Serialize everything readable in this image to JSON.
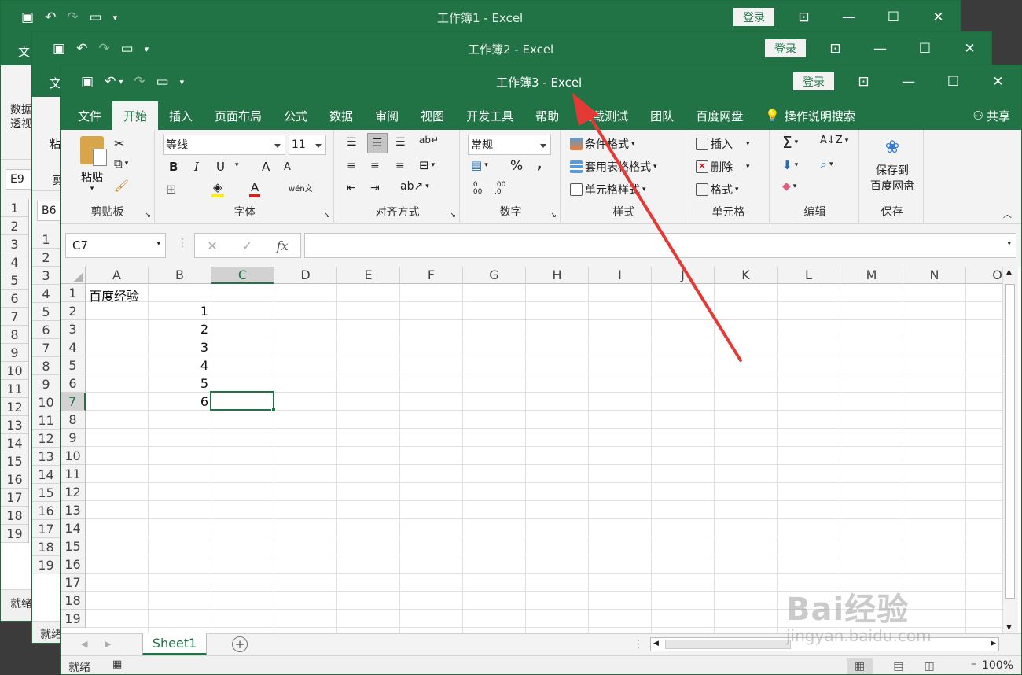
{
  "windows": [
    {
      "title": "工作簿1 - Excel",
      "login": "登录",
      "menu_peek": "文",
      "ribbon_peek": "数据\n透视",
      "namebox": "E9",
      "rows": [
        "1",
        "2",
        "3",
        "4",
        "5",
        "6",
        "7",
        "8",
        "9",
        "10",
        "11",
        "12",
        "13",
        "14",
        "15",
        "16",
        "17",
        "18",
        "19"
      ],
      "status": "就绪"
    },
    {
      "title": "工作簿2 - Excel",
      "login": "登录",
      "menu_peek": "文",
      "ribbon_peek": "粘",
      "ribbon_peek2": "剪",
      "namebox": "B6",
      "rows": [
        "1",
        "2",
        "3",
        "4",
        "5",
        "6",
        "7",
        "8",
        "9",
        "10",
        "11",
        "12",
        "13",
        "14",
        "15",
        "16",
        "17",
        "18",
        "19"
      ],
      "status": "就绪"
    }
  ],
  "main": {
    "title": "工作簿3 - Excel",
    "login": "登录",
    "share": "共享",
    "tell_me": "操作说明搜索",
    "menu": [
      "文件",
      "开始",
      "插入",
      "页面布局",
      "公式",
      "数据",
      "审阅",
      "视图",
      "开发工具",
      "帮助",
      "负载测试",
      "团队",
      "百度网盘"
    ],
    "active_menu": "开始",
    "ribbon": {
      "clipboard": {
        "paste": "粘贴",
        "label": "剪贴板"
      },
      "font": {
        "name": "等线",
        "size": "11",
        "bold": "B",
        "italic": "I",
        "underline": "U",
        "grow": "A",
        "shrink": "A",
        "color": "A",
        "phonetic": "wén文",
        "label": "字体"
      },
      "align": {
        "label": "对齐方式"
      },
      "number": {
        "format": "常规",
        "percent": "%",
        "comma": ",",
        "inc": ".0 .00",
        "dec": ".00 .0",
        "label": "数字"
      },
      "styles": {
        "cond": "条件格式",
        "table": "套用表格格式",
        "cell": "单元格样式",
        "label": "样式"
      },
      "cells": {
        "insert": "插入",
        "delete": "删除",
        "format": "格式",
        "label": "单元格"
      },
      "edit": {
        "label": "编辑"
      },
      "save": {
        "btn1": "保存到",
        "btn2": "百度网盘",
        "label": "保存"
      }
    },
    "namebox": "C7",
    "fx": "fx",
    "columns": [
      "A",
      "B",
      "C",
      "D",
      "E",
      "F",
      "G",
      "H",
      "I",
      "J",
      "K",
      "L",
      "M",
      "N",
      "O"
    ],
    "selected_column": "C",
    "rows": [
      "1",
      "2",
      "3",
      "4",
      "5",
      "6",
      "7",
      "8",
      "9",
      "10",
      "11",
      "12",
      "13",
      "14",
      "15",
      "16",
      "17",
      "18",
      "19"
    ],
    "selected_row": "7",
    "cells": {
      "A1": "百度经验",
      "B2": "1",
      "B3": "2",
      "B4": "3",
      "B5": "4",
      "B6": "5",
      "B7": "6"
    },
    "active_cell": "C7",
    "sheet_tab": "Sheet1",
    "status": "就绪",
    "zoom": "100%"
  },
  "watermark": {
    "line1": "Bai经验",
    "line2": "jingyan.baidu.com"
  },
  "colors": {
    "excel_green": "#217346",
    "arrow": "#e53935"
  }
}
